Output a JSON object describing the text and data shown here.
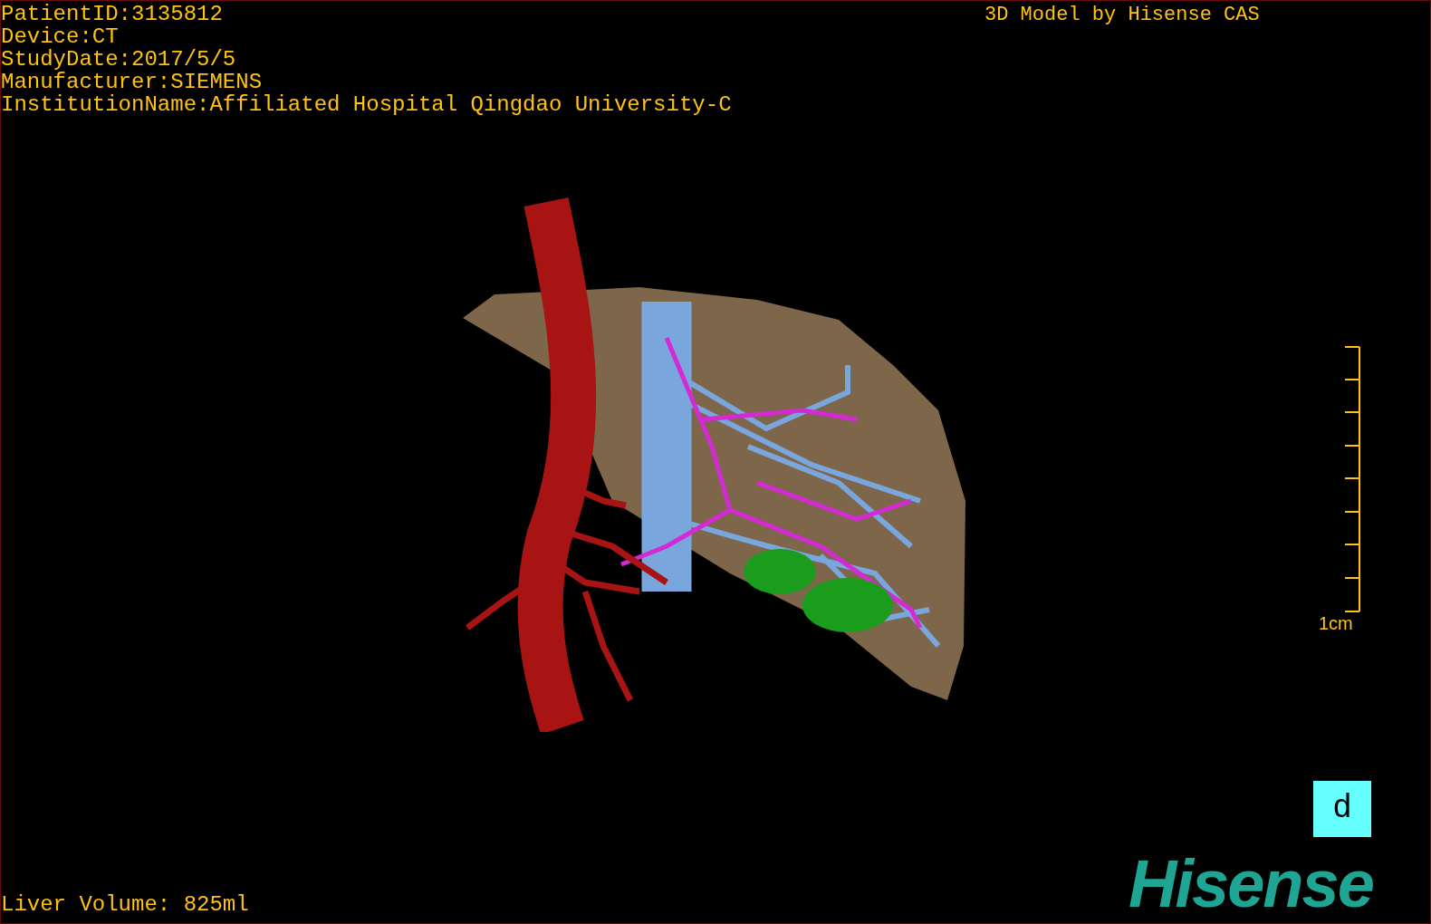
{
  "study_info": [
    "PatientID:3135812",
    "Device:CT",
    "StudyDate:2017/5/5",
    "Manufacturer:SIEMENS",
    "InstitutionName:Affiliated Hospital Qingdao University-C"
  ],
  "model_title": "3D Model by Hisense CAS",
  "scale_label": "1cm",
  "view_label": "d",
  "logo": "Hisense",
  "liver_volume": "Liver Volume: 825ml"
}
